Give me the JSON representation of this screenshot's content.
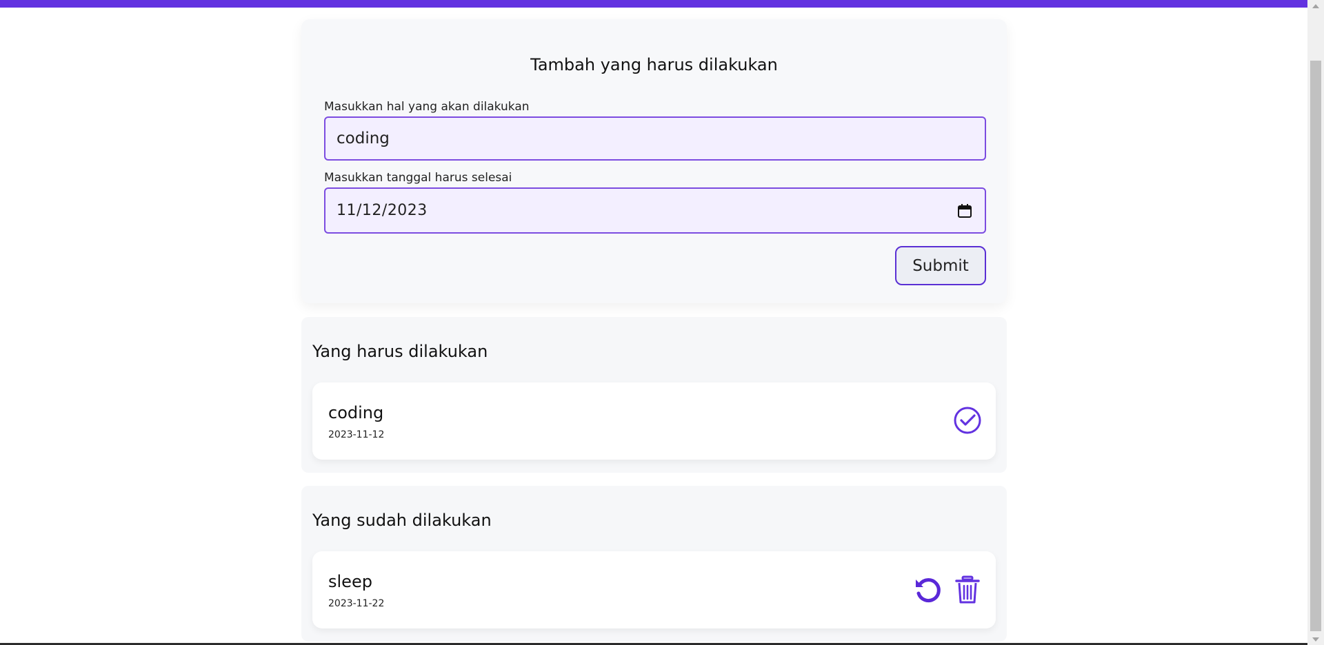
{
  "form": {
    "title": "Tambah yang harus dilakukan",
    "task_label": "Masukkan hal yang akan dilakukan",
    "task_value": "coding",
    "date_label": "Masukkan tanggal harus selesai",
    "date_value": "11/12/2023",
    "submit_label": "Submit"
  },
  "todo": {
    "title": "Yang harus dilakukan",
    "items": [
      {
        "title": "coding",
        "date": "2023-11-12"
      }
    ]
  },
  "done": {
    "title": "Yang sudah dilakukan",
    "items": [
      {
        "title": "sleep",
        "date": "2023-11-22"
      }
    ]
  },
  "colors": {
    "accent": "#6232e0",
    "input_bg": "#f3efff",
    "card_bg": "#f7f8fa"
  },
  "icons": {
    "calendar": "calendar-icon",
    "check": "check-circle-icon",
    "undo": "undo-icon",
    "trash": "trash-icon"
  }
}
